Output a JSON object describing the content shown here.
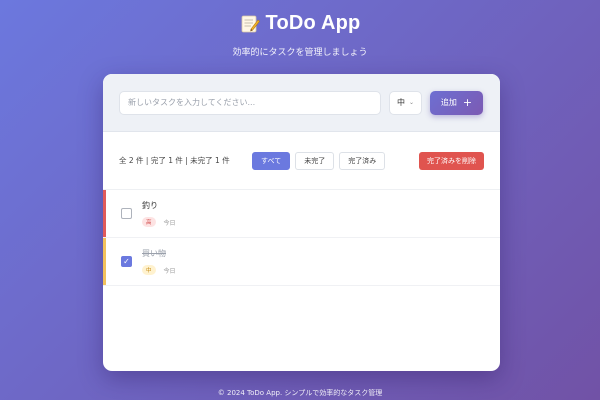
{
  "header": {
    "icon": "memo-icon",
    "title": "ToDo App",
    "subtitle": "効率的にタスクを管理しましょう"
  },
  "input": {
    "placeholder": "新しいタスクを入力してください...",
    "value": "",
    "priority_selected": "中",
    "add_label": "追加",
    "add_icon": "+"
  },
  "stats": {
    "text": "全 2 件 | 完了 1 件 | 未完了 1 件"
  },
  "filters": [
    {
      "label": "すべて",
      "active": true
    },
    {
      "label": "未完了",
      "active": false
    },
    {
      "label": "完了済み",
      "active": false
    }
  ],
  "clear_label": "完了済みを削除",
  "tasks": [
    {
      "text": "釣り",
      "priority": "高",
      "date": "今日",
      "done": false
    },
    {
      "text": "買い物",
      "priority": "中",
      "date": "今日",
      "done": true
    }
  ],
  "footer": "© 2024 ToDo App. シンプルで効率的なタスク管理",
  "colors": {
    "bg_start": "#6c78de",
    "bg_end": "#7152a6",
    "accent": "#6b79df",
    "danger": "#e0544f",
    "priority_high": "#e05a5a",
    "priority_mid": "#f2c15c"
  }
}
